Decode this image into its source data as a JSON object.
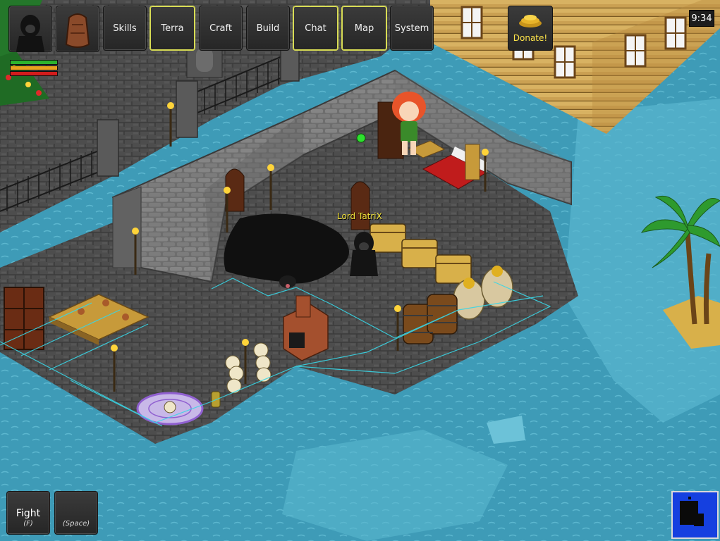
{
  "hud": {
    "menu": [
      "Skills",
      "Terra",
      "Craft",
      "Build",
      "Chat",
      "Map",
      "System"
    ],
    "donate_label": "Donate!",
    "clock": "9:34"
  },
  "player": {
    "name": "Lord TatriX",
    "health": 1.0,
    "stamina": 1.0,
    "mana": 1.0
  },
  "actions": {
    "fight_label": "Fight",
    "fight_key": "(F)",
    "space_key": "(Space)"
  },
  "colors": {
    "water": "#3e9bb7",
    "stone_floor": "#4c4c4c",
    "hud_highlight": "#d8dc54",
    "nameplate": "#f2e23b",
    "donate_text": "#ffe54a",
    "health": "#2db32d",
    "stamina": "#e8a21e",
    "mana": "#d21c1c"
  }
}
